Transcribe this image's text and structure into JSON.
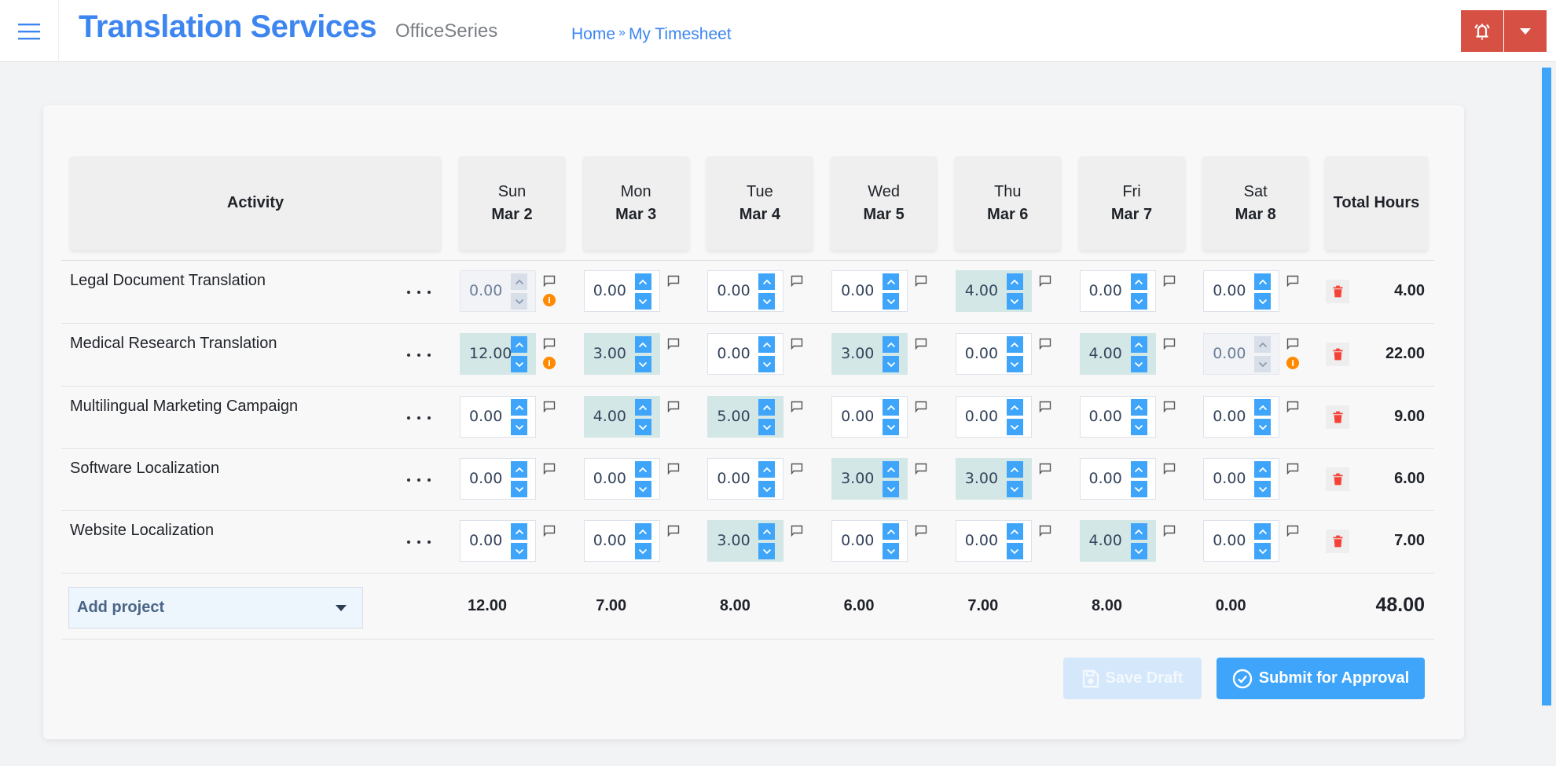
{
  "header": {
    "menu_icon": "hamburger-icon",
    "app_title": "Translation Services",
    "app_subtitle": "OfficeSeries",
    "breadcrumb": [
      {
        "label": "Home"
      },
      {
        "label": "My Timesheet"
      }
    ],
    "breadcrumb_separator": "»",
    "alert_icon": "bell-alert-icon",
    "dropdown_icon": "caret-down-icon"
  },
  "table": {
    "activity_header": "Activity",
    "total_header": "Total Hours",
    "days": [
      {
        "dow": "Sun",
        "date": "Mar 2"
      },
      {
        "dow": "Mon",
        "date": "Mar 3"
      },
      {
        "dow": "Tue",
        "date": "Mar 4"
      },
      {
        "dow": "Wed",
        "date": "Mar 5"
      },
      {
        "dow": "Thu",
        "date": "Mar 6"
      },
      {
        "dow": "Fri",
        "date": "Mar 7"
      },
      {
        "dow": "Sat",
        "date": "Mar 8"
      }
    ],
    "rows": [
      {
        "name": "Legal Document Translation",
        "total": "4.00",
        "cells": [
          {
            "value": "0.00",
            "state": "disabled",
            "info": true
          },
          {
            "value": "0.00",
            "state": "normal"
          },
          {
            "value": "0.00",
            "state": "normal"
          },
          {
            "value": "0.00",
            "state": "normal"
          },
          {
            "value": "4.00",
            "state": "filled"
          },
          {
            "value": "0.00",
            "state": "normal"
          },
          {
            "value": "0.00",
            "state": "normal"
          }
        ]
      },
      {
        "name": "Medical Research Translation",
        "total": "22.00",
        "cells": [
          {
            "value": "12.00",
            "state": "filled",
            "info": true
          },
          {
            "value": "3.00",
            "state": "filled"
          },
          {
            "value": "0.00",
            "state": "normal"
          },
          {
            "value": "3.00",
            "state": "filled"
          },
          {
            "value": "0.00",
            "state": "normal"
          },
          {
            "value": "4.00",
            "state": "filled"
          },
          {
            "value": "0.00",
            "state": "disabled",
            "info": true
          }
        ]
      },
      {
        "name": "Multilingual Marketing Campaign",
        "total": "9.00",
        "cells": [
          {
            "value": "0.00",
            "state": "normal"
          },
          {
            "value": "4.00",
            "state": "filled"
          },
          {
            "value": "5.00",
            "state": "filled"
          },
          {
            "value": "0.00",
            "state": "normal"
          },
          {
            "value": "0.00",
            "state": "normal"
          },
          {
            "value": "0.00",
            "state": "normal"
          },
          {
            "value": "0.00",
            "state": "normal"
          }
        ]
      },
      {
        "name": "Software Localization",
        "total": "6.00",
        "cells": [
          {
            "value": "0.00",
            "state": "normal"
          },
          {
            "value": "0.00",
            "state": "normal"
          },
          {
            "value": "0.00",
            "state": "normal"
          },
          {
            "value": "3.00",
            "state": "filled"
          },
          {
            "value": "3.00",
            "state": "filled"
          },
          {
            "value": "0.00",
            "state": "normal"
          },
          {
            "value": "0.00",
            "state": "normal"
          }
        ]
      },
      {
        "name": "Website Localization",
        "total": "7.00",
        "cells": [
          {
            "value": "0.00",
            "state": "normal"
          },
          {
            "value": "0.00",
            "state": "normal"
          },
          {
            "value": "3.00",
            "state": "filled"
          },
          {
            "value": "0.00",
            "state": "normal"
          },
          {
            "value": "0.00",
            "state": "normal"
          },
          {
            "value": "4.00",
            "state": "filled"
          },
          {
            "value": "0.00",
            "state": "normal"
          }
        ]
      }
    ],
    "day_totals": [
      "12.00",
      "7.00",
      "8.00",
      "6.00",
      "7.00",
      "8.00",
      "0.00"
    ],
    "grand_total": "48.00",
    "info_glyph": "i"
  },
  "footer": {
    "add_project_label": "Add project",
    "save_draft_label": "Save Draft",
    "submit_label": "Submit for Approval"
  },
  "colors": {
    "brand_blue": "#3d86f0",
    "accent_blue": "#3ea5fa",
    "alert_red": "#d65043",
    "filled_cell": "#d3e7e7",
    "info_orange": "#ff8a00",
    "delete_red": "#f44336"
  }
}
